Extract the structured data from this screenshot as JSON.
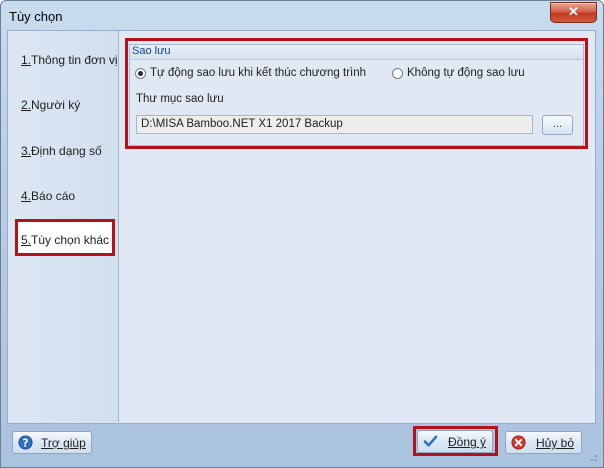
{
  "window": {
    "title": "Tùy chọn"
  },
  "nav": {
    "items": [
      {
        "num": "1.",
        "label": "Thông tin đơn vị"
      },
      {
        "num": "2.",
        "label": "Người ký"
      },
      {
        "num": "3.",
        "label": "Định dạng số"
      },
      {
        "num": "4.",
        "label": "Báo cáo"
      },
      {
        "num": "5.",
        "label": "Tùy chọn khác",
        "selected": true
      }
    ]
  },
  "backup": {
    "group_title": "Sao lưu",
    "option_auto": "Tự động sao lưu khi kết thúc chương trình",
    "option_none": "Không tự động sao lưu",
    "selected_option": "auto",
    "folder_label": "Thư mục sao lưu",
    "folder_value": "D:\\MISA Bamboo.NET X1 2017 Backup",
    "browse_label": "..."
  },
  "buttons": {
    "help": "Trợ giúp",
    "ok": "Đồng ý",
    "cancel": "Hủy bỏ"
  },
  "colors": {
    "highlight": "#b3121b",
    "accent": "#15428b"
  }
}
